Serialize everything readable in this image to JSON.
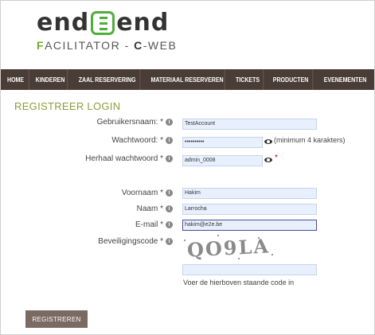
{
  "brand": {
    "logo_left": "end",
    "logo_right": "end",
    "sub_accent": "F",
    "sub_rest": "ACILITATOR - ",
    "sub_c": "C",
    "sub_web": "-WEB"
  },
  "nav": {
    "items": [
      "HOME",
      "KINDEREN",
      "ZAAL RESERVERING",
      "MATERIAAL RESERVEREN",
      "TICKETS",
      "PRODUCTEN",
      "EVENEMENTEN"
    ]
  },
  "page_title": "REGISTREER LOGIN",
  "form": {
    "username_label": "Gebruikersnaam: *",
    "username_value": "TestAccount",
    "password_label": "Wachtwoord: *",
    "password_value": "••••••••••",
    "password_hint": "(minimum 4 karakters)",
    "password_repeat_label": "Herhaal wachtwoord *",
    "password_repeat_value": "admin_0008",
    "password_repeat_required": "*",
    "firstname_label": "Voornaam *",
    "firstname_value": "Hakim",
    "lastname_label": "Naam *",
    "lastname_value": "Larrocha",
    "email_label": "E-mail *",
    "email_value": "hakim@e2e.be",
    "captcha_label": "Beveiligingscode *",
    "captcha_image_text": "QO9LA",
    "captcha_value": "",
    "captcha_hint": "Voer de hierboven staande code in"
  },
  "buttons": {
    "register": "REGISTREREN"
  },
  "colors": {
    "nav_bg": "#4a3d37",
    "title": "#8a9e3c",
    "logo_green": "#4fae3a",
    "button_bg": "#7b6a62",
    "input_bg": "#e8f0fe",
    "required": "#cc0000"
  },
  "icons": {
    "info": "info-circle-icon",
    "eye": "eye-icon",
    "logo": "bracket-logo-icon"
  }
}
